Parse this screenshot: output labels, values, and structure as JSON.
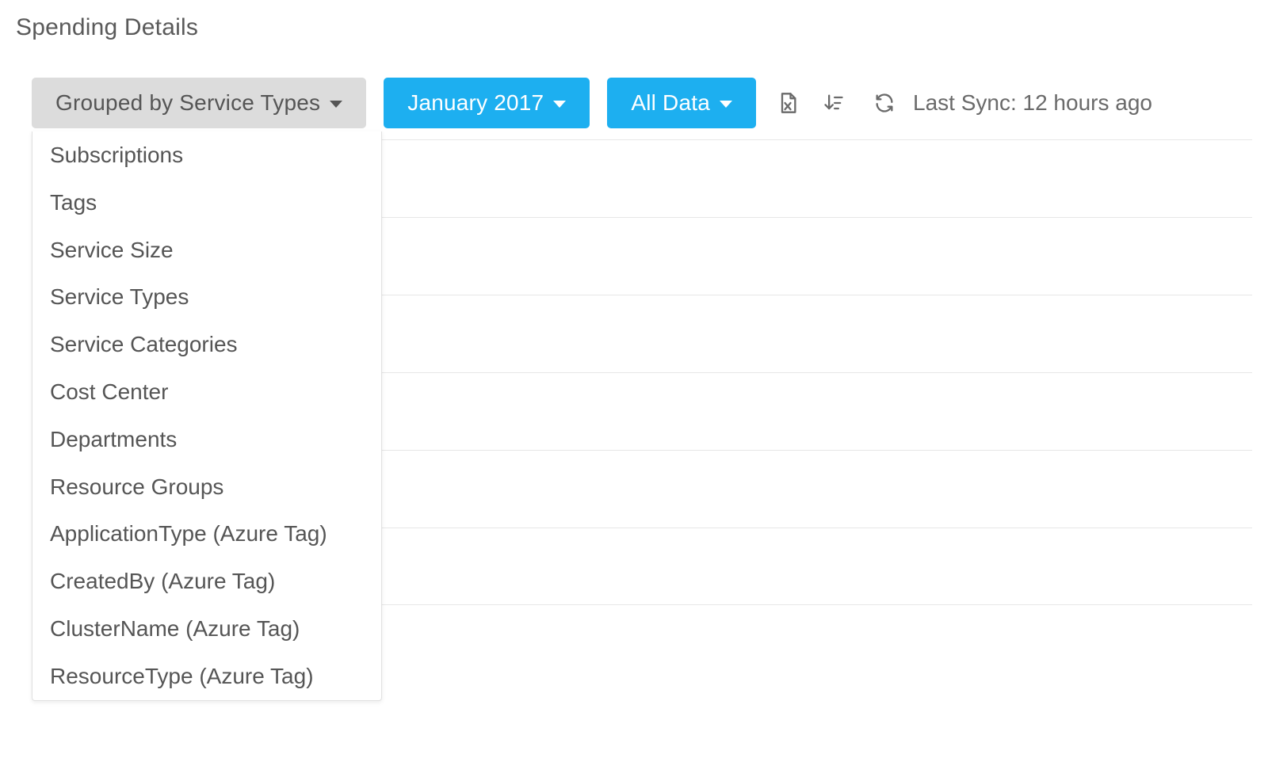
{
  "header": {
    "title": "Spending Details"
  },
  "toolbar": {
    "group_by_label": "Grouped by Service Types",
    "period_label": "January 2017",
    "scope_label": "All Data",
    "sync_label": "Last Sync: 12 hours ago"
  },
  "group_dropdown": {
    "options": [
      "Subscriptions",
      "Tags",
      "Service Size",
      "Service Types",
      "Service Categories",
      "Cost Center",
      "Departments",
      "Resource Groups",
      "ApplicationType (Azure Tag)",
      "CreatedBy (Azure Tag)",
      "ClusterName (Azure Tag)",
      "ResourceType (Azure Tag)"
    ]
  },
  "rows": {
    "markers": [
      "#e0883a",
      "#2c3e50",
      "#1daff0",
      "#2c3e50",
      "#2c3e50",
      "#2c3e50"
    ]
  }
}
